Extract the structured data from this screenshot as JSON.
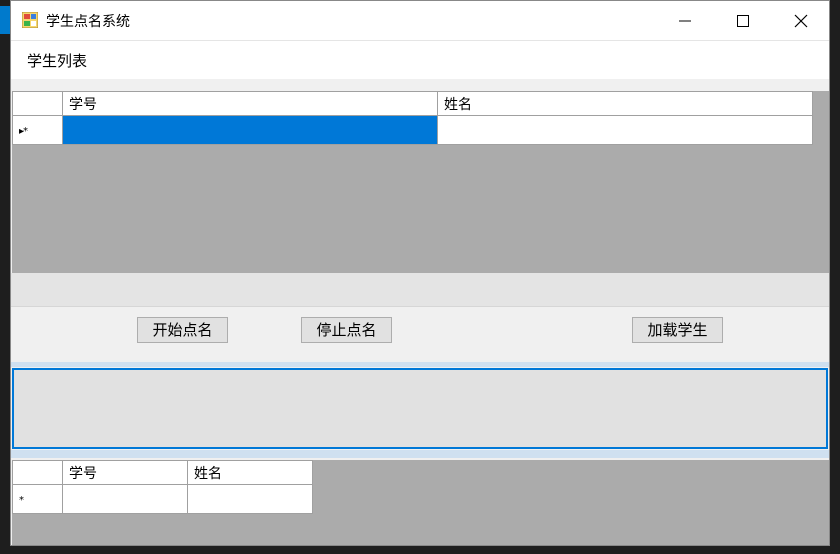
{
  "window": {
    "title": "学生点名系统"
  },
  "titlebar": {
    "minimize_icon": "minimize-icon",
    "maximize_icon": "maximize-icon",
    "close_icon": "close-icon"
  },
  "menu": {
    "items": [
      {
        "label": "学生列表"
      }
    ]
  },
  "top_grid": {
    "columns": [
      "学号",
      "姓名"
    ],
    "row_header": "▸*"
  },
  "buttons": {
    "start": "开始点名",
    "stop": "停止点名",
    "load": "加载学生"
  },
  "bottom_grid": {
    "columns": [
      "学号",
      "姓名"
    ],
    "row_header": "*"
  },
  "colors": {
    "selection": "#0078d7",
    "grid_background": "#ababab",
    "form_background": "#f0f0f0"
  }
}
